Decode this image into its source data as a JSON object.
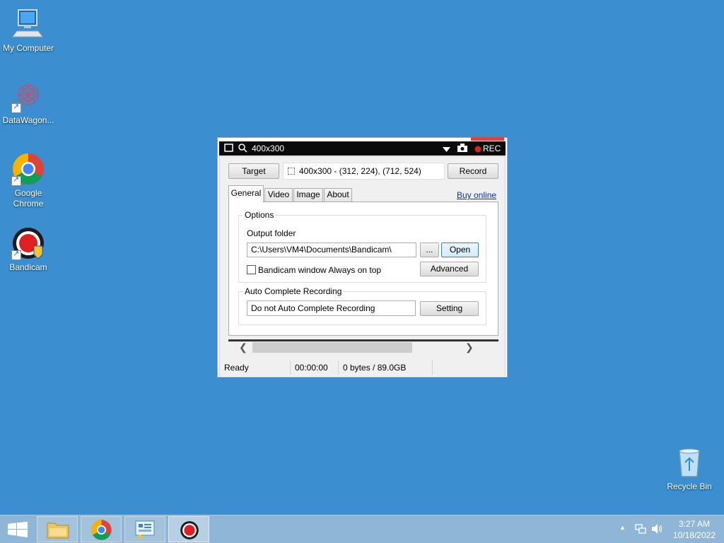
{
  "desktop": {
    "icons": [
      {
        "label": "My Computer"
      },
      {
        "label": "DataWagon..."
      },
      {
        "label": "Google Chrome"
      },
      {
        "label": "Bandicam"
      },
      {
        "label": "Recycle Bin"
      }
    ]
  },
  "window": {
    "title": "400x300",
    "rec_label": "REC",
    "target_button": "Target",
    "region_text": "400x300 - (312, 224), (712, 524)",
    "record_button": "Record",
    "tabs": [
      "General",
      "Video",
      "Image",
      "About"
    ],
    "buy_online": "Buy online",
    "options": {
      "group_title": "Options",
      "output_folder_label": "Output folder",
      "output_folder_value": "C:\\Users\\VM4\\Documents\\Bandicam\\",
      "browse_button": "...",
      "open_button": "Open",
      "always_on_top_label": "Bandicam window Always on top",
      "advanced_button": "Advanced"
    },
    "auto_complete": {
      "group_title": "Auto Complete Recording",
      "value": "Do not Auto Complete Recording",
      "setting_button": "Setting"
    },
    "status": {
      "state": "Ready",
      "time": "00:00:00",
      "size": "0 bytes / 89.0GB"
    }
  },
  "taskbar": {
    "time": "3:27 AM",
    "date": "10/18/2022"
  },
  "colors": {
    "desktop": "#3b8fd0",
    "taskbar": "#8fb6d6",
    "rec_dot": "#e02020"
  }
}
